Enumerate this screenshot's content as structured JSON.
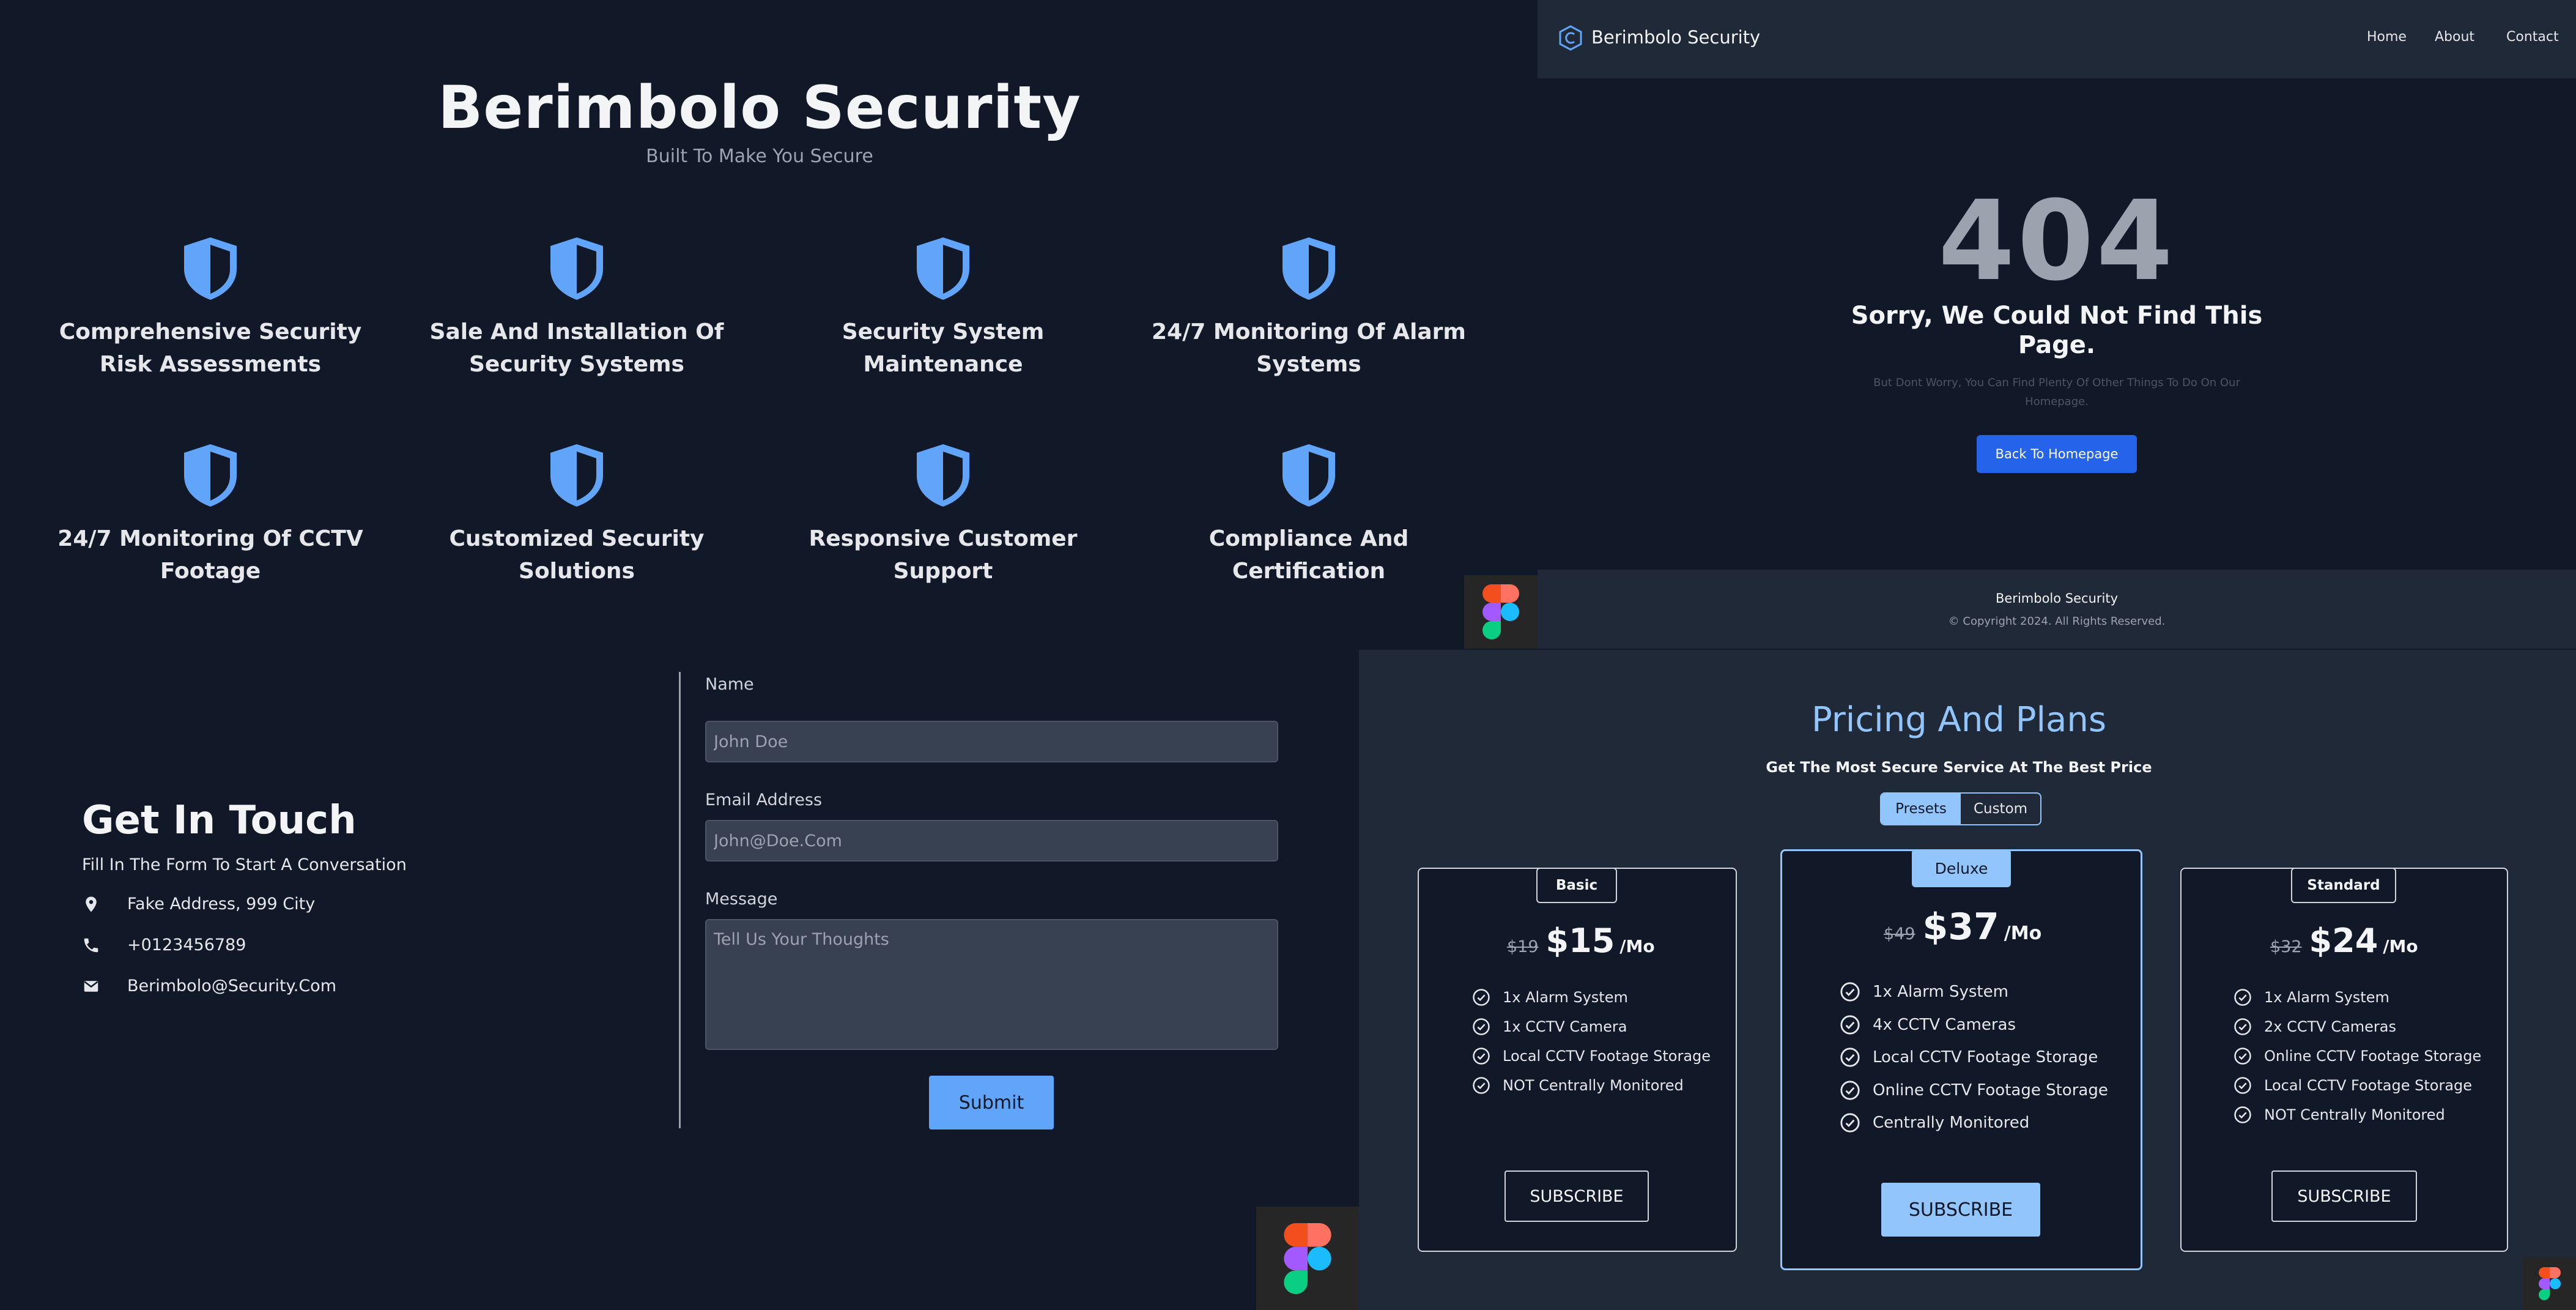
{
  "services_section": {
    "title": "Berimbolo Security",
    "subtitle": "Built To Make You Secure",
    "services": [
      "Comprehensive Security Risk Assessments",
      "Sale And Installation Of Security Systems",
      "Security System Maintenance",
      "24/7 Monitoring Of Alarm Systems",
      "24/7 Monitoring Of CCTV Footage",
      "Customized Security Solutions",
      "Responsive Customer Support",
      "Compliance And Certification"
    ],
    "icon": "shield-icon"
  },
  "error_page": {
    "nav": {
      "brand": "Berimbolo Security",
      "logo_icon": "copyright-logo-icon",
      "links": [
        "Home",
        "About",
        "Contact"
      ]
    },
    "code": "404",
    "title": "Sorry, We Could Not Find This Page.",
    "description": "But Dont Worry, You Can Find Plenty Of Other Things To Do On Our Homepage.",
    "button_label": "Back To Homepage",
    "footer": {
      "brand": "Berimbolo Security",
      "copyright": "© Copyright 2024. All Rights Reserved."
    }
  },
  "contact": {
    "title": "Get In Touch",
    "subtitle": "Fill In The Form To Start A Conversation",
    "address": "Fake Address, 999 City",
    "phone": "+0123456789",
    "email": "Berimbolo@Security.Com",
    "form": {
      "name_label": "Name",
      "name_placeholder": "John Doe",
      "email_label": "Email Address",
      "email_placeholder": "John@Doe.Com",
      "message_label": "Message",
      "message_placeholder": "Tell Us Your Thoughts",
      "submit_label": "Submit"
    }
  },
  "pricing": {
    "title": "Pricing And Plans",
    "subtitle": "Get The Most Secure Service At The Best Price",
    "toggle": [
      "Presets",
      "Custom"
    ],
    "active_toggle": "Presets",
    "per_label": "/Mo",
    "plans": [
      {
        "name": "Basic",
        "old_price": "$19",
        "price": "$15",
        "features": [
          "1x Alarm System",
          "1x CCTV Camera",
          "Local CCTV Footage Storage",
          "NOT Centrally Monitored"
        ],
        "button": "SUBSCRIBE"
      },
      {
        "name": "Deluxe",
        "old_price": "$49",
        "price": "$37",
        "features": [
          "1x Alarm System",
          "4x CCTV Cameras",
          "Local CCTV Footage Storage",
          "Online CCTV Footage Storage",
          "Centrally Monitored"
        ],
        "button": "SUBSCRIBE"
      },
      {
        "name": "Standard",
        "old_price": "$32",
        "price": "$24",
        "features": [
          "1x Alarm System",
          "2x CCTV Cameras",
          "Online CCTV Footage Storage",
          "Local CCTV Footage Storage",
          "NOT Centrally Monitored"
        ],
        "button": "SUBSCRIBE"
      }
    ]
  },
  "colors": {
    "background": "#111827",
    "panel": "#1f2937",
    "accent_light_blue": "#93c5fd",
    "accent_blue": "#60a5fa",
    "primary_button": "#2563eb"
  }
}
